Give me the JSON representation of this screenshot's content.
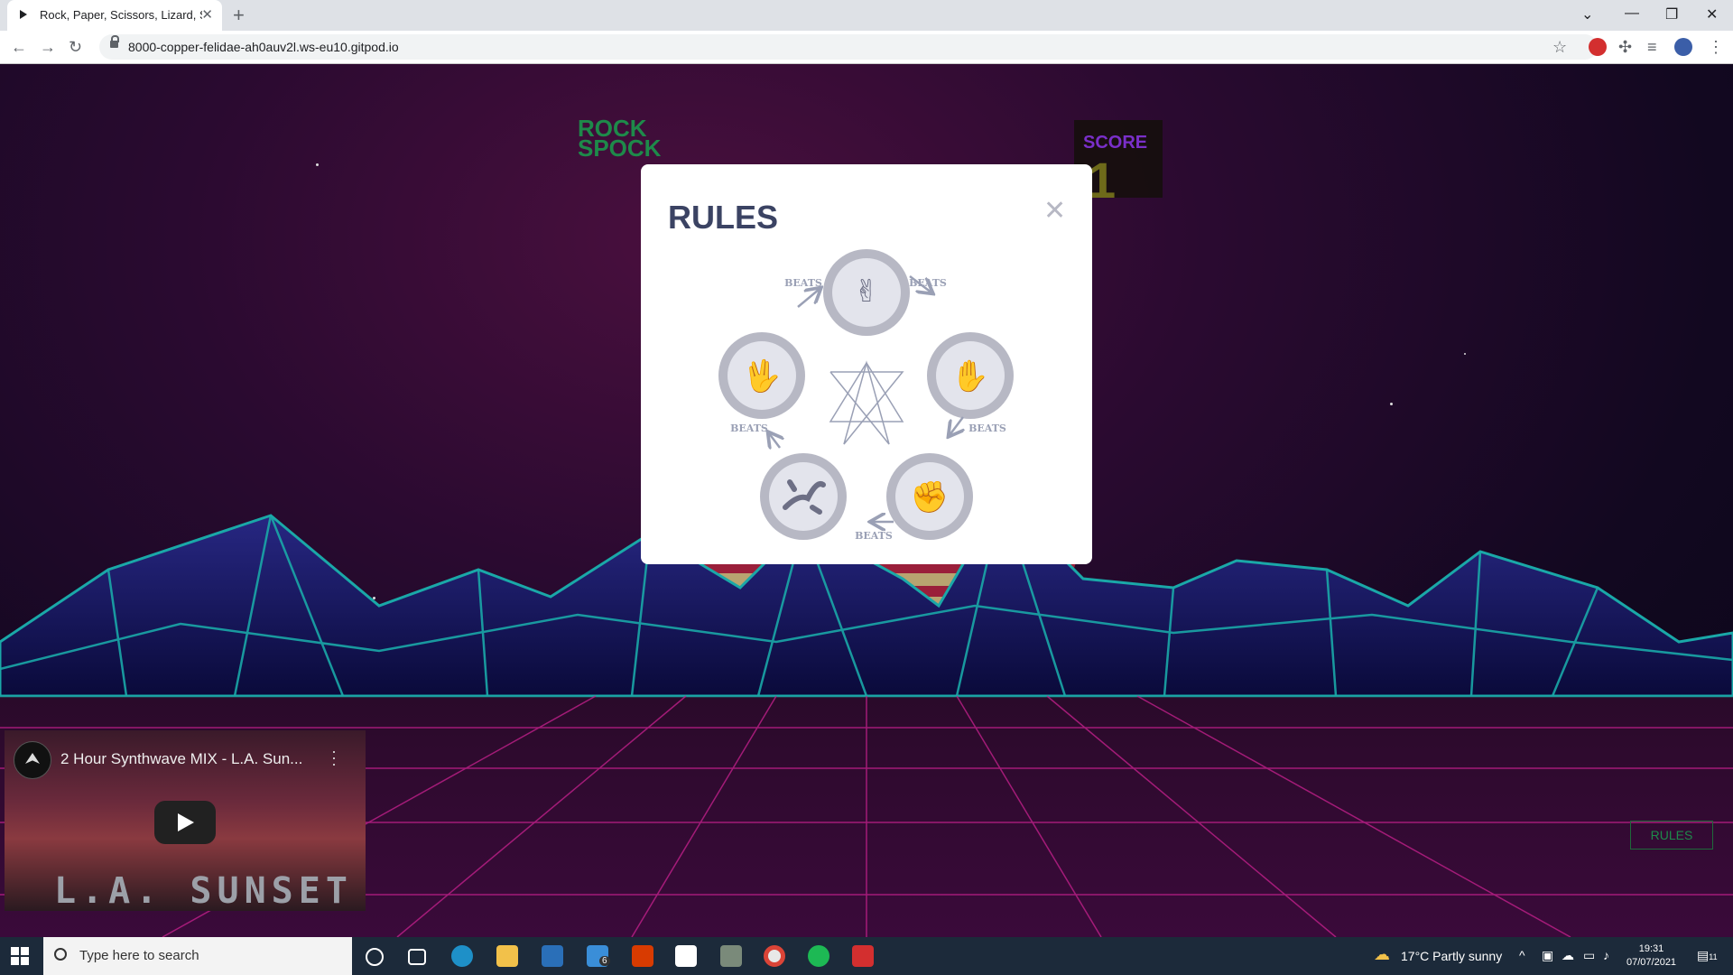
{
  "browser": {
    "tab_title": "Rock, Paper, Scissors, Lizard, Spock",
    "url": "8000-copper-felidae-ah0auv2l.ws-eu10.gitpod.io",
    "close_tab_symbol": "✕",
    "new_tab_symbol": "+"
  },
  "game": {
    "title_line1": "ROCK",
    "title_line2": "SPOCK",
    "score_label": "SCORE",
    "score_value": "1",
    "rules_button": "RULES"
  },
  "modal": {
    "title": "RULES",
    "close_symbol": "✕",
    "beats_label": "BEATS",
    "choices": [
      "scissors",
      "paper",
      "rock",
      "lizard",
      "spock"
    ]
  },
  "video": {
    "title": "2 Hour Synthwave MIX - L.A. Sun...",
    "caption": "L.A. SUNSET"
  },
  "taskbar": {
    "search_placeholder": "Type here to search",
    "weather": "17°C  Partly sunny",
    "time": "19:31",
    "date": "07/07/2021",
    "mail_badge": "6",
    "notification_badge": "11"
  },
  "colors": {
    "modal_title": "#3b4363",
    "token_ring": "#b7b8c4",
    "neon_grid": "#1aa8a8"
  }
}
